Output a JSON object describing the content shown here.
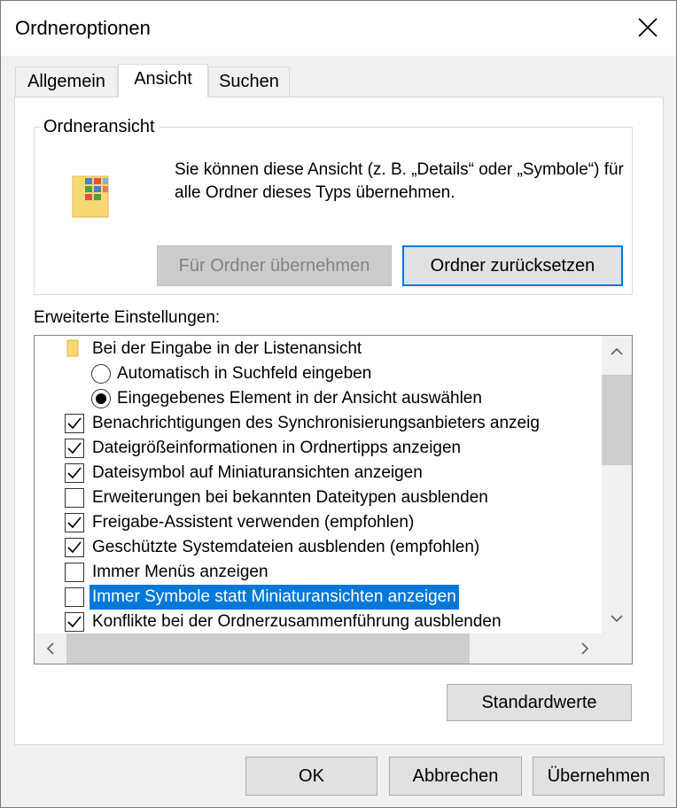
{
  "window": {
    "title": "Ordneroptionen"
  },
  "tabs": [
    {
      "label": "Allgemein",
      "active": false
    },
    {
      "label": "Ansicht",
      "active": true
    },
    {
      "label": "Suchen",
      "active": false
    }
  ],
  "folder_view": {
    "legend": "Ordneransicht",
    "description": "Sie können diese Ansicht (z. B. „Details“ oder „Symbole“) für alle Ordner dieses Typs übernehmen.",
    "apply_button": "Für Ordner übernehmen",
    "reset_button": "Ordner zurücksetzen"
  },
  "advanced": {
    "label": "Erweiterte Einstellungen:",
    "items": [
      {
        "kind": "folder",
        "label": "Bei der Eingabe in der Listenansicht",
        "level": 0
      },
      {
        "kind": "radio",
        "label": "Automatisch in Suchfeld eingeben",
        "checked": false,
        "level": 1
      },
      {
        "kind": "radio",
        "label": "Eingegebenes Element in der Ansicht auswählen",
        "checked": true,
        "level": 1
      },
      {
        "kind": "checkbox",
        "label": "Benachrichtigungen des Synchronisierungsanbieters anzeig",
        "checked": true,
        "level": 0
      },
      {
        "kind": "checkbox",
        "label": "Dateigrößeinformationen in Ordnertipps anzeigen",
        "checked": true,
        "level": 0
      },
      {
        "kind": "checkbox",
        "label": "Dateisymbol auf Miniaturansichten anzeigen",
        "checked": true,
        "level": 0
      },
      {
        "kind": "checkbox",
        "label": "Erweiterungen bei bekannten Dateitypen ausblenden",
        "checked": false,
        "level": 0
      },
      {
        "kind": "checkbox",
        "label": "Freigabe-Assistent verwenden (empfohlen)",
        "checked": true,
        "level": 0
      },
      {
        "kind": "checkbox",
        "label": "Geschützte Systemdateien ausblenden (empfohlen)",
        "checked": true,
        "level": 0
      },
      {
        "kind": "checkbox",
        "label": "Immer Menüs anzeigen",
        "checked": false,
        "level": 0
      },
      {
        "kind": "checkbox",
        "label": "Immer Symbole statt Miniaturansichten anzeigen",
        "checked": false,
        "level": 0,
        "selected": true
      },
      {
        "kind": "checkbox",
        "label": "Konflikte bei der Ordnerzusammenführung ausblenden",
        "checked": true,
        "level": 0
      }
    ]
  },
  "defaults_button": "Standardwerte",
  "footer": {
    "ok": "OK",
    "cancel": "Abbrechen",
    "apply": "Übernehmen"
  },
  "colors": {
    "accent": "#0078d7",
    "selection": "#0078d7",
    "dialog_bg": "#f0f0f0"
  }
}
